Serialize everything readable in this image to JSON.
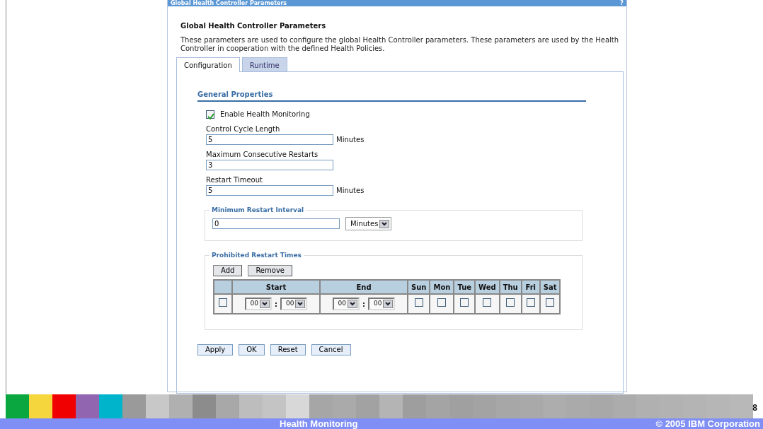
{
  "window": {
    "title": "Global Health Controller Parameters",
    "help": "?"
  },
  "heading": "Global Health Controller Parameters",
  "description": "These parameters are used to configure the global Health Controller parameters. These parameters are used by the Health Controller in cooperation with the defined Health Policies.",
  "tabs": [
    {
      "label": "Configuration",
      "selected": true
    },
    {
      "label": "Runtime",
      "selected": false
    }
  ],
  "general_properties": {
    "title": "General Properties",
    "enable": {
      "label": "Enable Health Monitoring",
      "checked": true
    },
    "fields": [
      {
        "label": "Control Cycle Length",
        "value": "5",
        "unit": "Minutes"
      },
      {
        "label": "Maximum Consecutive Restarts",
        "value": "3"
      },
      {
        "label": "Restart Timeout",
        "value": "5",
        "unit": "Minutes"
      }
    ]
  },
  "minimum_restart_interval": {
    "title": "Minimum Restart Interval",
    "value": "0",
    "unit": "Minutes"
  },
  "prohibited_restart_times": {
    "title": "Prohibited Restart Times",
    "buttons": [
      "Add",
      "Remove"
    ],
    "columns": [
      "Start",
      "End",
      "Sun",
      "Mon",
      "Tue",
      "Wed",
      "Thu",
      "Fri",
      "Sat"
    ],
    "rows": [
      {
        "selected": false,
        "start_hour": "00",
        "start_minute": "00",
        "end_hour": "00",
        "end_minute": "00",
        "separator": ":",
        "days": [
          {
            "checked": false
          },
          {
            "checked": false
          },
          {
            "checked": false
          },
          {
            "checked": false
          },
          {
            "checked": false
          },
          {
            "checked": false
          },
          {
            "checked": false
          }
        ]
      }
    ]
  },
  "buttons": [
    "Apply",
    "OK",
    "Reset",
    "Cancel"
  ],
  "slide": {
    "page_number": "8",
    "footer_title": "Health Monitoring",
    "copyright": "© 2005 IBM Corporation"
  }
}
